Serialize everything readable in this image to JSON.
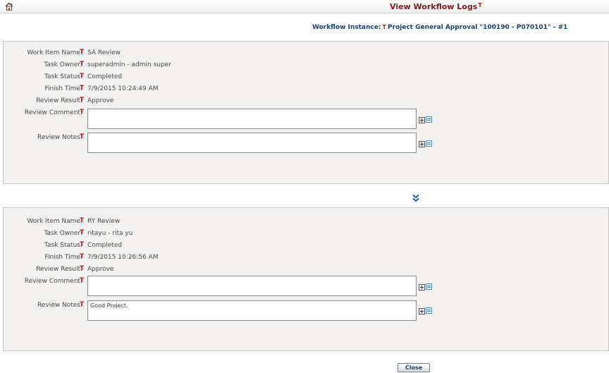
{
  "header": {
    "title": "View Workflow Logs",
    "title_marker": "T",
    "home_icon": "home-icon"
  },
  "instance": {
    "label": "Workflow Instance:",
    "marker": "T",
    "value": "Project General Approval \"100190 - P070101\" - #1"
  },
  "labels": {
    "work_item": "Work Item Name:",
    "task_owner": "Task Owner:",
    "task_status": "Task Status:",
    "finish_time": "Finish Time:",
    "review_result": "Review Result:",
    "review_comment": "Review Comment:",
    "review_notes": "Review Notes:",
    "marker": "T"
  },
  "logs": [
    {
      "work_item": "SA Review",
      "task_owner": "superadmin - admin super",
      "task_status": "Completed",
      "finish_time": "7/9/2015 10:24:49 AM",
      "review_result": "Approve",
      "review_comment": "",
      "review_notes": ""
    },
    {
      "work_item": "RY Review",
      "task_owner": "ritayu - rita yu",
      "task_status": "Completed",
      "finish_time": "7/9/2015 10:26:56 AM",
      "review_result": "Approve",
      "review_comment": "",
      "review_notes": "Good Project."
    }
  ],
  "footer": {
    "close_label": "Close"
  },
  "colors": {
    "title": "#7b1b1b",
    "marker": "#c1171b",
    "link": "#1d3e66",
    "panel_bg": "#f2f1f0"
  },
  "icons": [
    "home-icon",
    "expand-icon",
    "notes-icon",
    "double-chevron-down-icon"
  ]
}
